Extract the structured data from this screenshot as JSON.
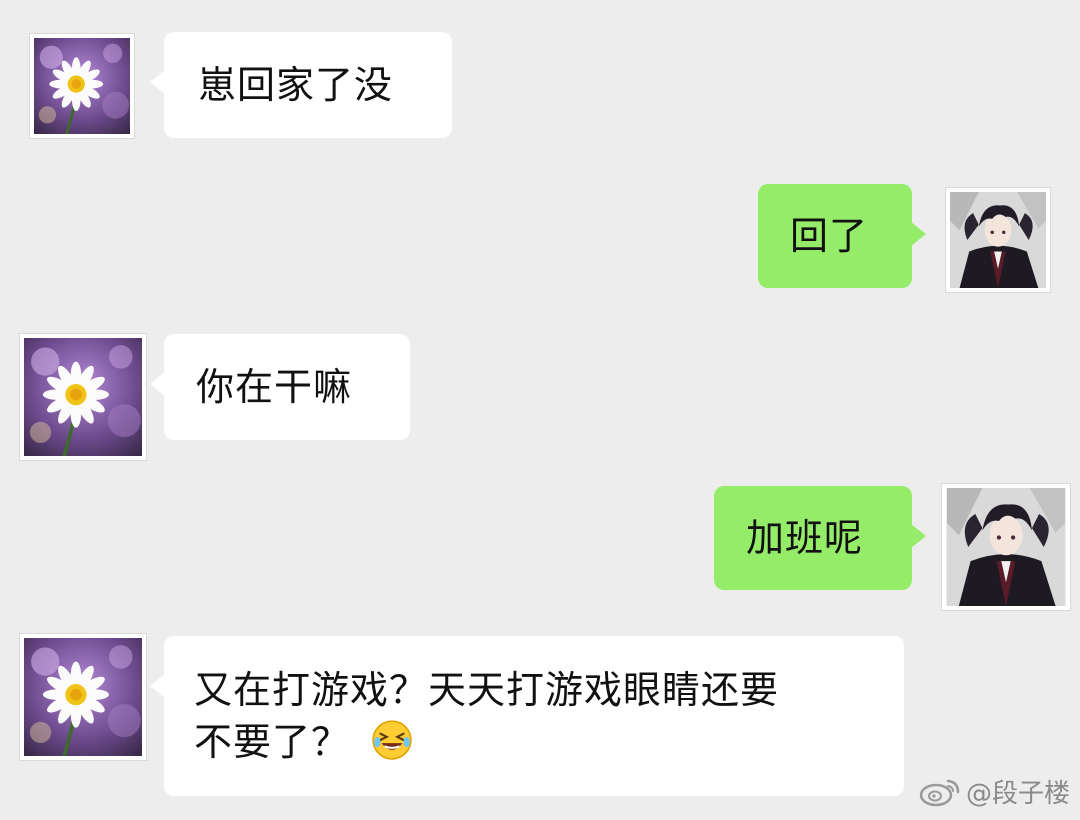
{
  "messages": [
    {
      "side": "in",
      "text": "崽回家了没"
    },
    {
      "side": "out",
      "text": "回了"
    },
    {
      "side": "in",
      "text": "你在干嘛"
    },
    {
      "side": "out",
      "text": "加班呢"
    },
    {
      "side": "in",
      "line1": "又在打游戏？天天打游戏眼睛还要",
      "line2": "不要了？",
      "emoji": "laughing-crying-emoji"
    }
  ],
  "avatars": {
    "incoming": "daisy-flower-avatar",
    "outgoing": "anime-character-avatar"
  },
  "watermark": {
    "text": "@段子楼",
    "icon": "weibo-icon"
  },
  "colors": {
    "background": "#ededed",
    "incoming_bubble": "#ffffff",
    "outgoing_bubble": "#95ec69"
  }
}
